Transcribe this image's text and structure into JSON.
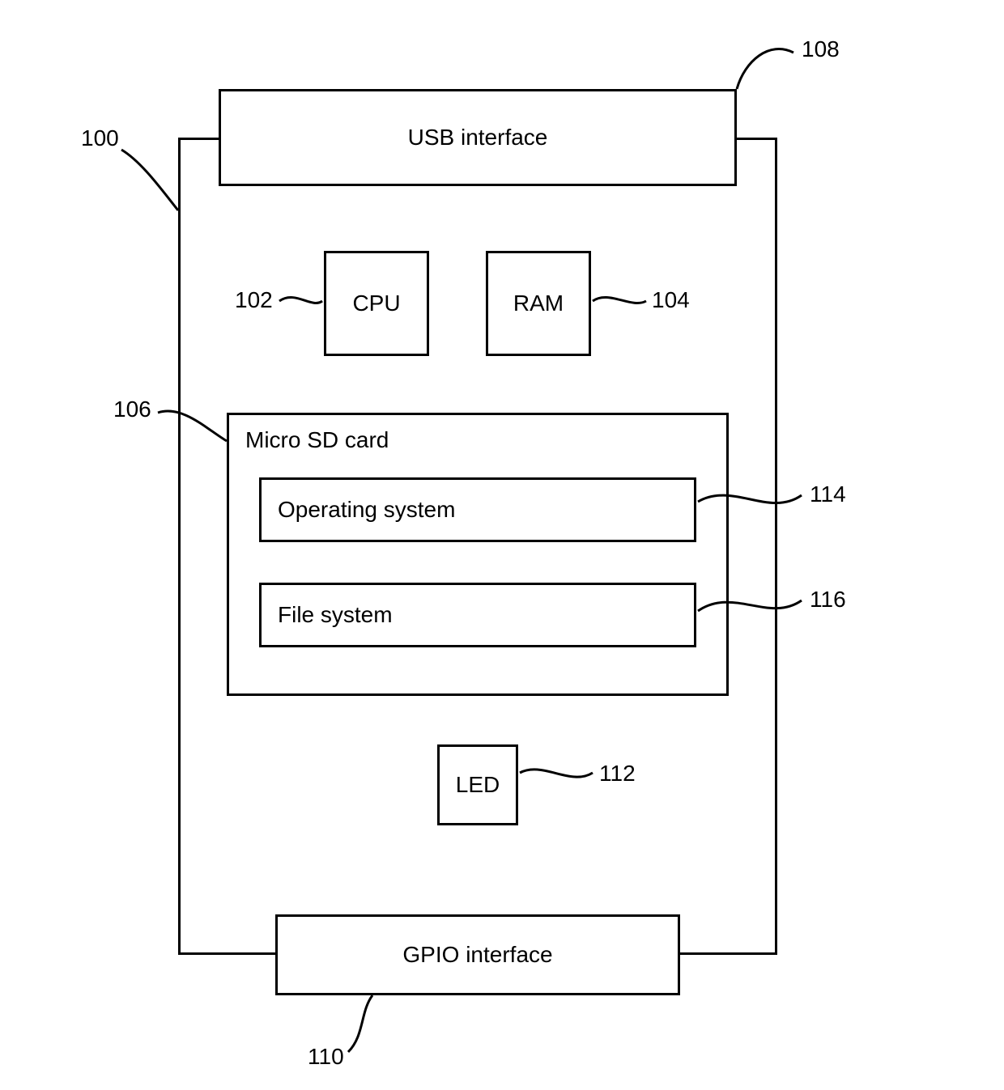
{
  "blocks": {
    "usb": {
      "label": "USB interface",
      "ref": "108"
    },
    "cpu": {
      "label": "CPU",
      "ref": "102"
    },
    "ram": {
      "label": "RAM",
      "ref": "104"
    },
    "sdcard": {
      "label": "Micro SD card",
      "ref": "106"
    },
    "os": {
      "label": "Operating system",
      "ref": "114"
    },
    "fs": {
      "label": "File system",
      "ref": "116"
    },
    "led": {
      "label": "LED",
      "ref": "112"
    },
    "gpio": {
      "label": "GPIO interface",
      "ref": "110"
    },
    "main": {
      "ref": "100"
    }
  }
}
